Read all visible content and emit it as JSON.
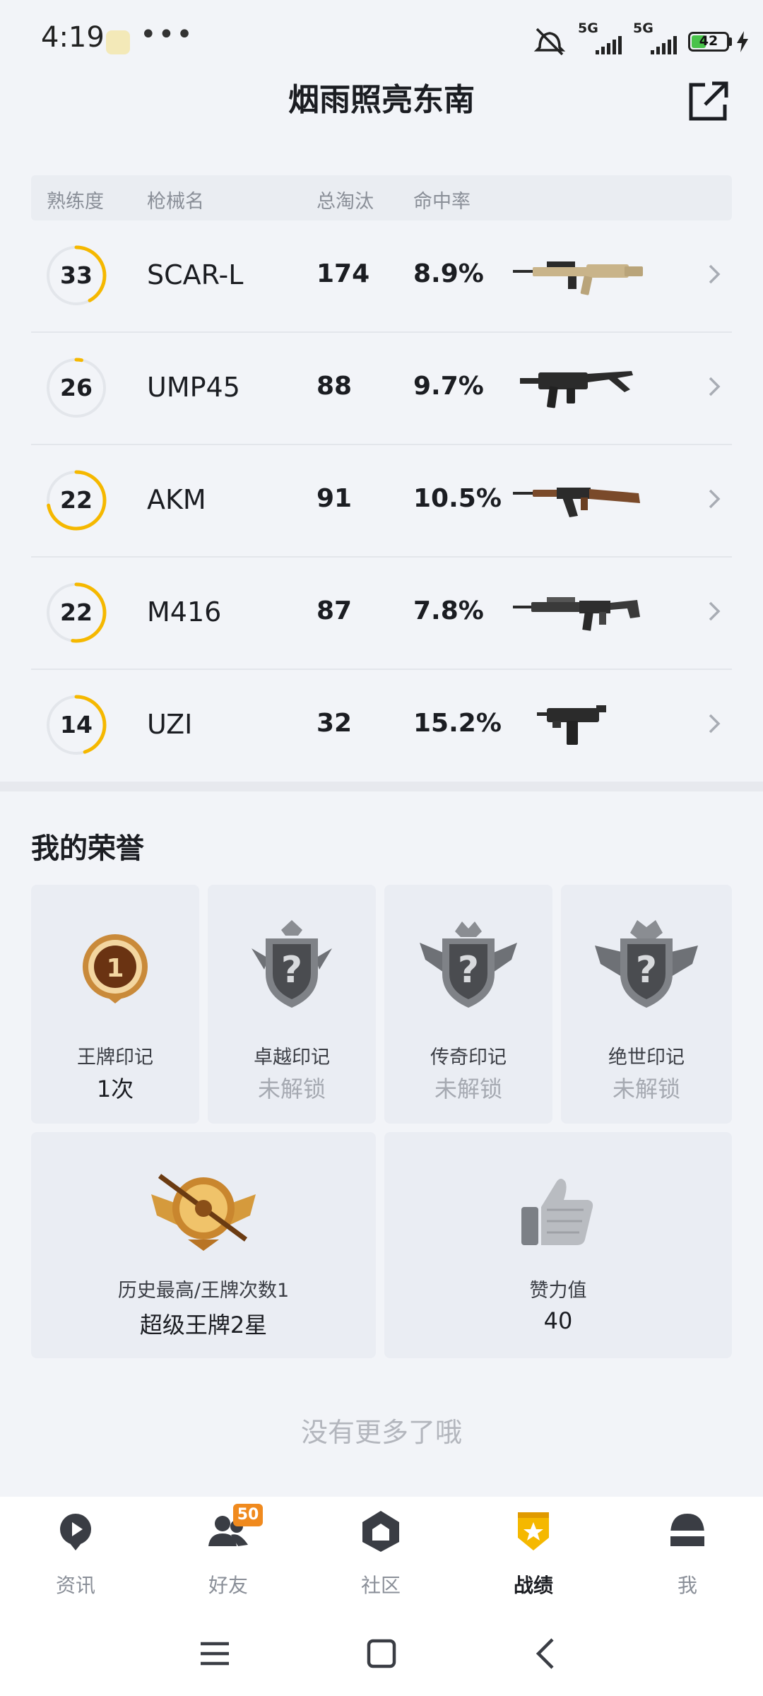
{
  "status_bar": {
    "time": "4:19",
    "more": "•••",
    "signal1": "5G",
    "signal2": "5G",
    "battery": "42",
    "battery_level": 0.42
  },
  "header": {
    "title": "烟雨照亮东南"
  },
  "table": {
    "headers": {
      "proficiency": "熟练度",
      "name": "枪械名",
      "kills": "总淘汰",
      "accuracy": "命中率"
    },
    "rows": [
      {
        "level": "33",
        "progress": 0.42,
        "name": "SCAR-L",
        "kills": "174",
        "accuracy": "8.9%"
      },
      {
        "level": "26",
        "progress": 0.03,
        "name": "UMP45",
        "kills": "88",
        "accuracy": "9.7%"
      },
      {
        "level": "22",
        "progress": 0.72,
        "name": "AKM",
        "kills": "91",
        "accuracy": "10.5%"
      },
      {
        "level": "22",
        "progress": 0.52,
        "name": "M416",
        "kills": "87",
        "accuracy": "7.8%"
      },
      {
        "level": "14",
        "progress": 0.45,
        "name": "UZI",
        "kills": "32",
        "accuracy": "15.2%"
      }
    ]
  },
  "honor": {
    "title": "我的荣誉",
    "marks": [
      {
        "label": "王牌印记",
        "value": "1次",
        "locked": false
      },
      {
        "label": "卓越印记",
        "value": "未解锁",
        "locked": true
      },
      {
        "label": "传奇印记",
        "value": "未解锁",
        "locked": true
      },
      {
        "label": "绝世印记",
        "value": "未解锁",
        "locked": true
      }
    ],
    "best": {
      "label": "历史最高/王牌次数1",
      "value": "超级王牌2星"
    },
    "likes": {
      "label": "赞力值",
      "value": "40"
    }
  },
  "end_text": "没有更多了哦",
  "nav": {
    "items": [
      {
        "label": "资讯",
        "icon": "news-icon"
      },
      {
        "label": "好友",
        "icon": "friends-icon",
        "badge": "50"
      },
      {
        "label": "社区",
        "icon": "community-icon"
      },
      {
        "label": "战绩",
        "icon": "record-icon",
        "active": true
      },
      {
        "label": "我",
        "icon": "helmet-icon"
      }
    ]
  },
  "colors": {
    "accent": "#f5b800",
    "background": "#f2f4f8",
    "badge": "#f08a1e"
  }
}
